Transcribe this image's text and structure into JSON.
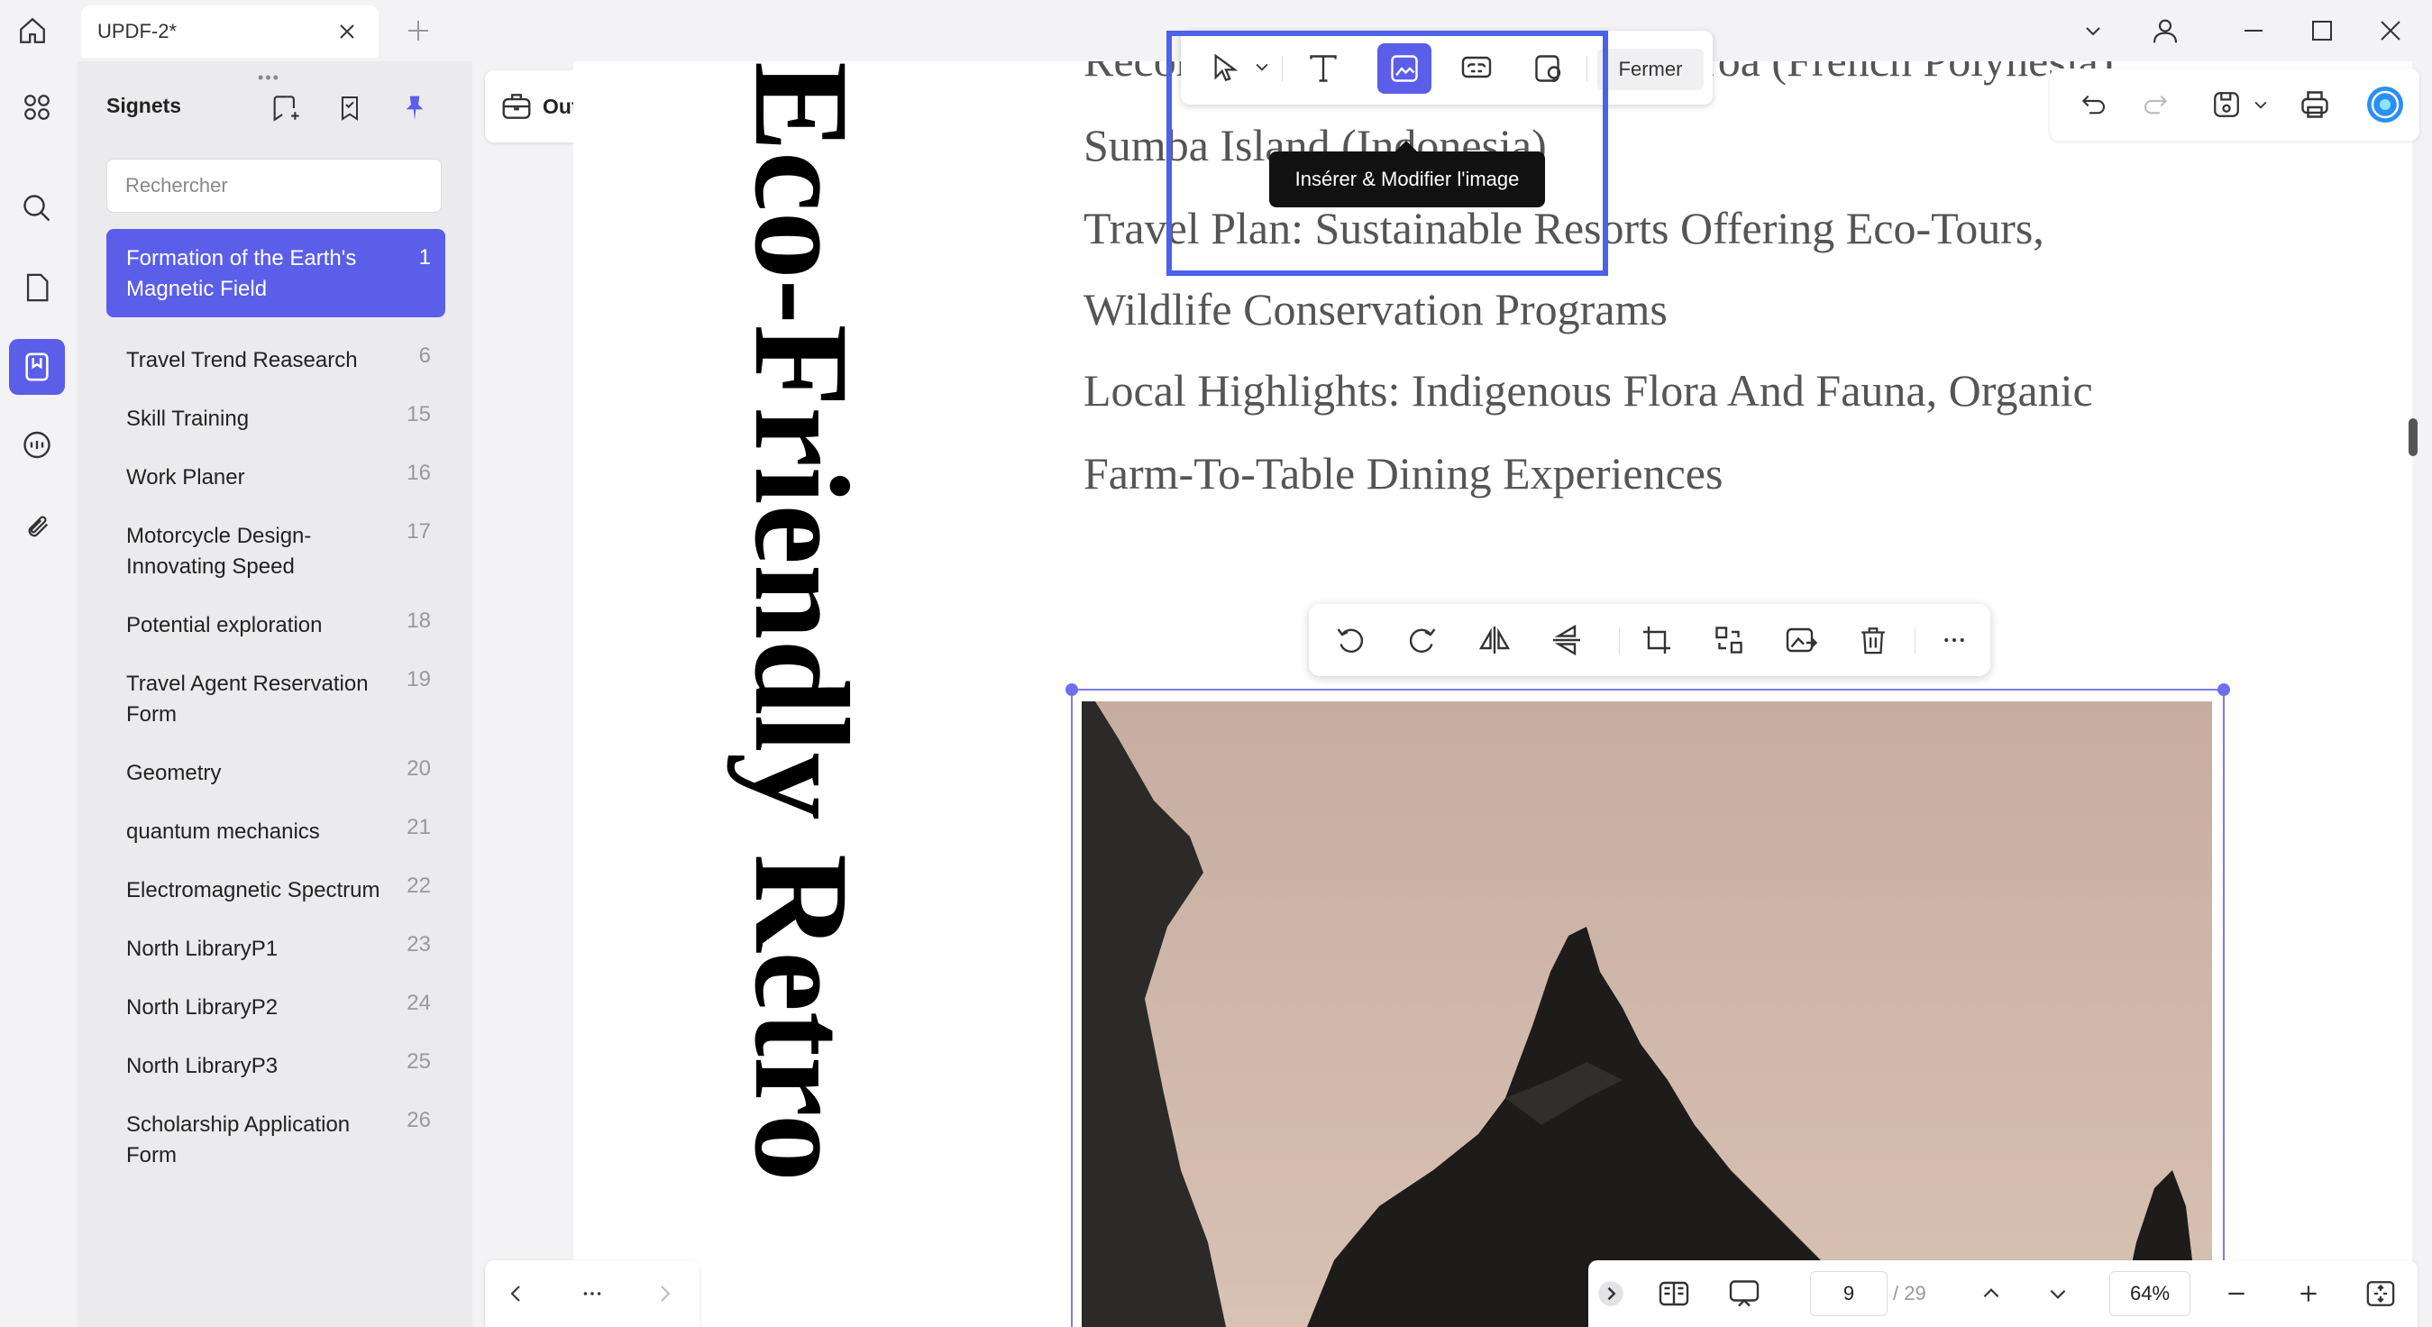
{
  "titlebar": {
    "tab_title": "UPDF-2*"
  },
  "panel": {
    "title": "Signets",
    "grip": "•••",
    "search_placeholder": "Rechercher",
    "bookmarks": [
      {
        "label": "Formation of the Earth's Magnetic Field",
        "page": "1",
        "active": true
      },
      {
        "label": "Travel Trend Reasearch",
        "page": "6"
      },
      {
        "label": "Skill Training",
        "page": "15"
      },
      {
        "label": "Work Planer",
        "page": "16"
      },
      {
        "label": "Motorcycle Design-Innovating Speed",
        "page": "17"
      },
      {
        "label": "Potential exploration",
        "page": "18"
      },
      {
        "label": "Travel Agent Reservation Form",
        "page": "19"
      },
      {
        "label": "Geometry",
        "page": "20"
      },
      {
        "label": "quantum mechanics",
        "page": "21"
      },
      {
        "label": "Electromagnetic Spectrum",
        "page": "22"
      },
      {
        "label": "North LibraryP1",
        "page": "23"
      },
      {
        "label": "North LibraryP2",
        "page": "24"
      },
      {
        "label": "North LibraryP3",
        "page": "25"
      },
      {
        "label": "Scholarship Application Form",
        "page": "26"
      }
    ]
  },
  "tools": {
    "label": "Outils"
  },
  "edit_toolbar": {
    "close_label": "Fermer",
    "tooltip": "Insérer & Modifier l'image"
  },
  "document": {
    "vertical_title": "Eco-Friendly Retro",
    "lines": [
      "Recommended Destinations: Tetiaroa (French Polynesia)",
      "Sumba Island (Indonesia)",
      "Travel Plan: Sustainable Resorts Offering Eco-Tours,",
      "Wildlife Conservation Programs",
      "Local Highlights: Indigenous Flora And Fauna, Organic",
      "Farm-To-Table Dining Experiences"
    ]
  },
  "bottom_bar": {
    "current_page": "9",
    "total_pages": "/ 29",
    "zoom": "64%"
  },
  "colors": {
    "accent": "#5b5ee9",
    "highlight": "#4a63e8",
    "photo_sky": "#c9b3a6"
  }
}
